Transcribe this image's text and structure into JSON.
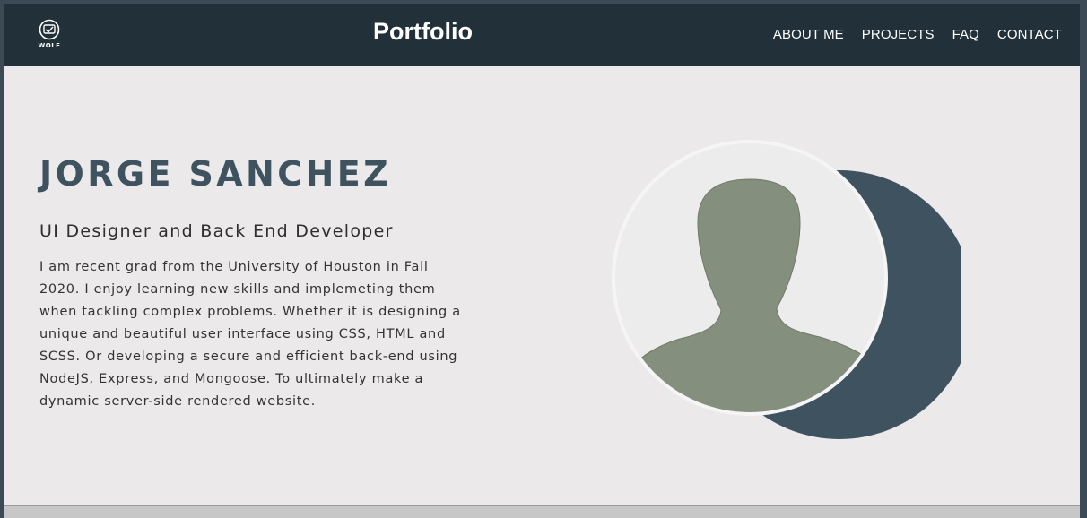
{
  "navbar": {
    "logo_text": "WOLF",
    "brand": "Portfolio",
    "links": [
      {
        "label": "ABOUT ME"
      },
      {
        "label": "PROJECTS"
      },
      {
        "label": "FAQ"
      },
      {
        "label": "CONTACT"
      }
    ]
  },
  "hero": {
    "name": "JORGE SANCHEZ",
    "role": "UI Designer and Back End Developer",
    "bio": "I am recent grad from the University of Houston in Fall 2020. I enjoy learning new skills and implemeting them when tackling complex problems. Whether it is designing a unique and beautiful user interface using CSS, HTML and SCSS. Or developing a secure and efficient back-end using NodeJS, Express, and Mongoose. To ultimately make a dynamic server-side rendered website."
  },
  "colors": {
    "navbar_bg": "#22303a",
    "page_bg": "#ebe9ea",
    "accent": "#3e5260",
    "avatar_silhouette": "#858f7e"
  }
}
